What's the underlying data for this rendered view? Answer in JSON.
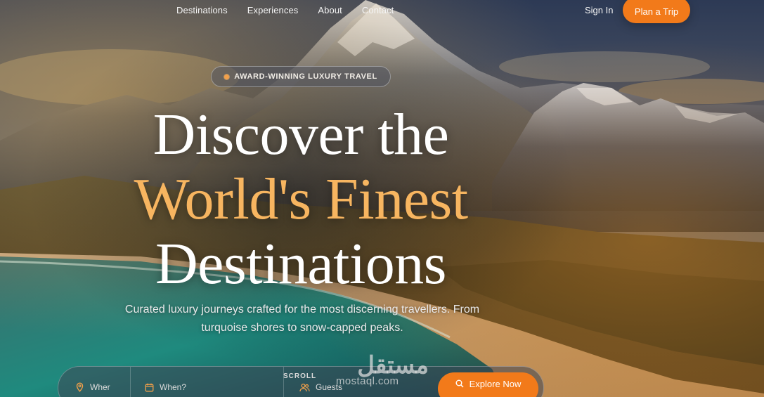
{
  "nav": {
    "links": [
      "Destinations",
      "Experiences",
      "About",
      "Contact"
    ],
    "sign_in": "Sign In",
    "cta": "Plan a Trip"
  },
  "hero": {
    "badge": "AWARD-WINNING LUXURY TRAVEL",
    "headline": [
      "Discover the",
      "World's Finest",
      "Destinations"
    ],
    "subtitle": "Curated luxury journeys crafted for the most discerning travellers. From turquoise shores to snow-capped peaks."
  },
  "search": {
    "where_placeholder": "Wher",
    "when_placeholder": "When?",
    "guests_placeholder": "Guests",
    "submit_label": "Explore Now",
    "where_icon": "location-pin-icon",
    "when_icon": "calendar-icon",
    "guests_icon": "users-icon",
    "submit_icon": "search-icon"
  },
  "scroll_indicator": "SCROLL",
  "watermark": {
    "arabic": "مستقل",
    "latin": "mostaql.com"
  },
  "colors": {
    "accent": "#f27a1a",
    "headline_gold": "#f7b560",
    "badge_dot": "#f2a04a"
  }
}
